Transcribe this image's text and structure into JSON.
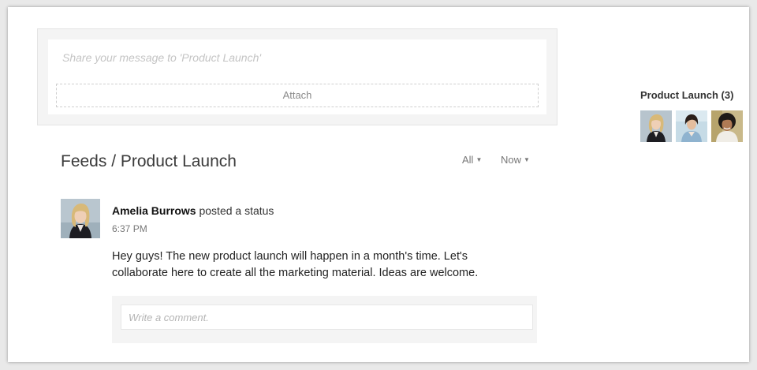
{
  "composer": {
    "placeholder": "Share your message to 'Product Launch'",
    "attach_label": "Attach"
  },
  "feed": {
    "title": "Feeds / Product Launch",
    "filters": [
      {
        "label": "All"
      },
      {
        "label": "Now"
      }
    ]
  },
  "post": {
    "author": "Amelia Burrows",
    "action": "posted a status",
    "time": "6:37 PM",
    "body": "Hey guys! The new product launch will happen in a month's time. Let's collaborate here to create all the marketing material. Ideas are welcome.",
    "comment_placeholder": "Write a comment."
  },
  "group": {
    "title": "Product Launch (3)",
    "members": [
      {
        "avatar": "woman-blonde-avatar"
      },
      {
        "avatar": "woman-dark-hair-avatar"
      },
      {
        "avatar": "woman-curly-hair-avatar"
      }
    ]
  },
  "colors": {
    "background": "#e9e9e9",
    "panel": "#f4f4f4",
    "text": "#222222",
    "muted": "#777777"
  }
}
